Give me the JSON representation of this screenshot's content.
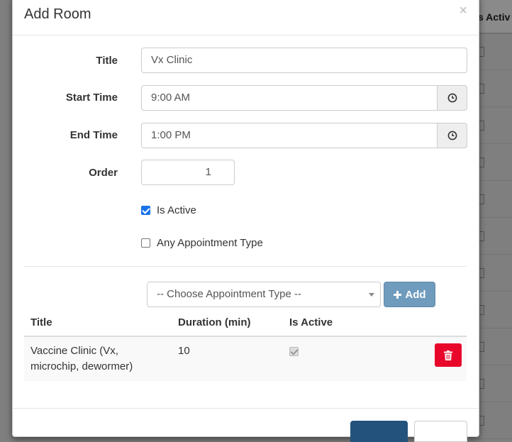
{
  "background": {
    "header_text": "s Activ"
  },
  "modal": {
    "title": "Add Room",
    "close_glyph": "×",
    "form": {
      "title_label": "Title",
      "title_value": "Vx Clinic",
      "start_label": "Start Time",
      "start_value": "9:00 AM",
      "end_label": "End Time",
      "end_value": "1:00 PM",
      "order_label": "Order",
      "order_value": "1",
      "is_active_label": "Is Active",
      "is_active_checked": true,
      "any_type_label": "Any Appointment Type",
      "any_type_checked": false
    },
    "appointment": {
      "select_value": "-- Choose Appointment Type --",
      "add_label": "Add",
      "columns": [
        "Title",
        "Duration (min)",
        "Is Active"
      ],
      "rows": [
        {
          "title": "Vaccine Clinic (Vx, microchip, dewormer)",
          "duration": "10",
          "is_active": true
        }
      ]
    }
  },
  "icons": {
    "clock": "clock-icon",
    "plus": "plus-icon",
    "trash": "trash-icon",
    "close": "close-icon"
  },
  "colors": {
    "accent": "#1a73e8",
    "add_button": "#6f9bbd",
    "delete_button": "#e8072a",
    "primary_button": "#23527c"
  }
}
